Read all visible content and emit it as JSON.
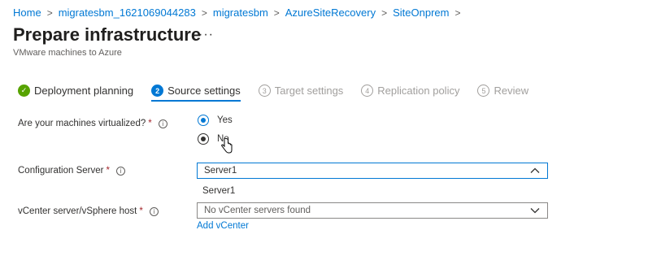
{
  "breadcrumb": [
    "Home",
    "migratesbm_1621069044283",
    "migratesbm",
    "AzureSiteRecovery",
    "SiteOnprem"
  ],
  "breadcrumb_separator": ">",
  "page": {
    "title": "Prepare infrastructure",
    "more_label": "···",
    "subtitle": "VMware machines to Azure"
  },
  "steps": [
    {
      "badge": "✓",
      "label": "Deployment planning",
      "state": "done"
    },
    {
      "badge": "2",
      "label": "Source settings",
      "state": "active"
    },
    {
      "badge": "3",
      "label": "Target settings",
      "state": "pending"
    },
    {
      "badge": "4",
      "label": "Replication policy",
      "state": "pending"
    },
    {
      "badge": "5",
      "label": "Review",
      "state": "pending"
    }
  ],
  "form": {
    "virtualized": {
      "label": "Are your machines virtualized?",
      "required": "*",
      "info": "i",
      "options": [
        {
          "label": "Yes",
          "checked": true
        },
        {
          "label": "No",
          "checked": false
        }
      ]
    },
    "config_server": {
      "label": "Configuration Server",
      "required": "*",
      "info": "i",
      "value": "Server1",
      "options": [
        "Server1"
      ],
      "open": true
    },
    "vcenter": {
      "label": "vCenter server/vSphere host",
      "required": "*",
      "info": "i",
      "placeholder": "No vCenter servers found",
      "add_link": "Add vCenter"
    }
  },
  "colors": {
    "accent": "#0078d4",
    "success": "#57a300",
    "required": "#a4262c",
    "disabled": "#a19f9d"
  }
}
